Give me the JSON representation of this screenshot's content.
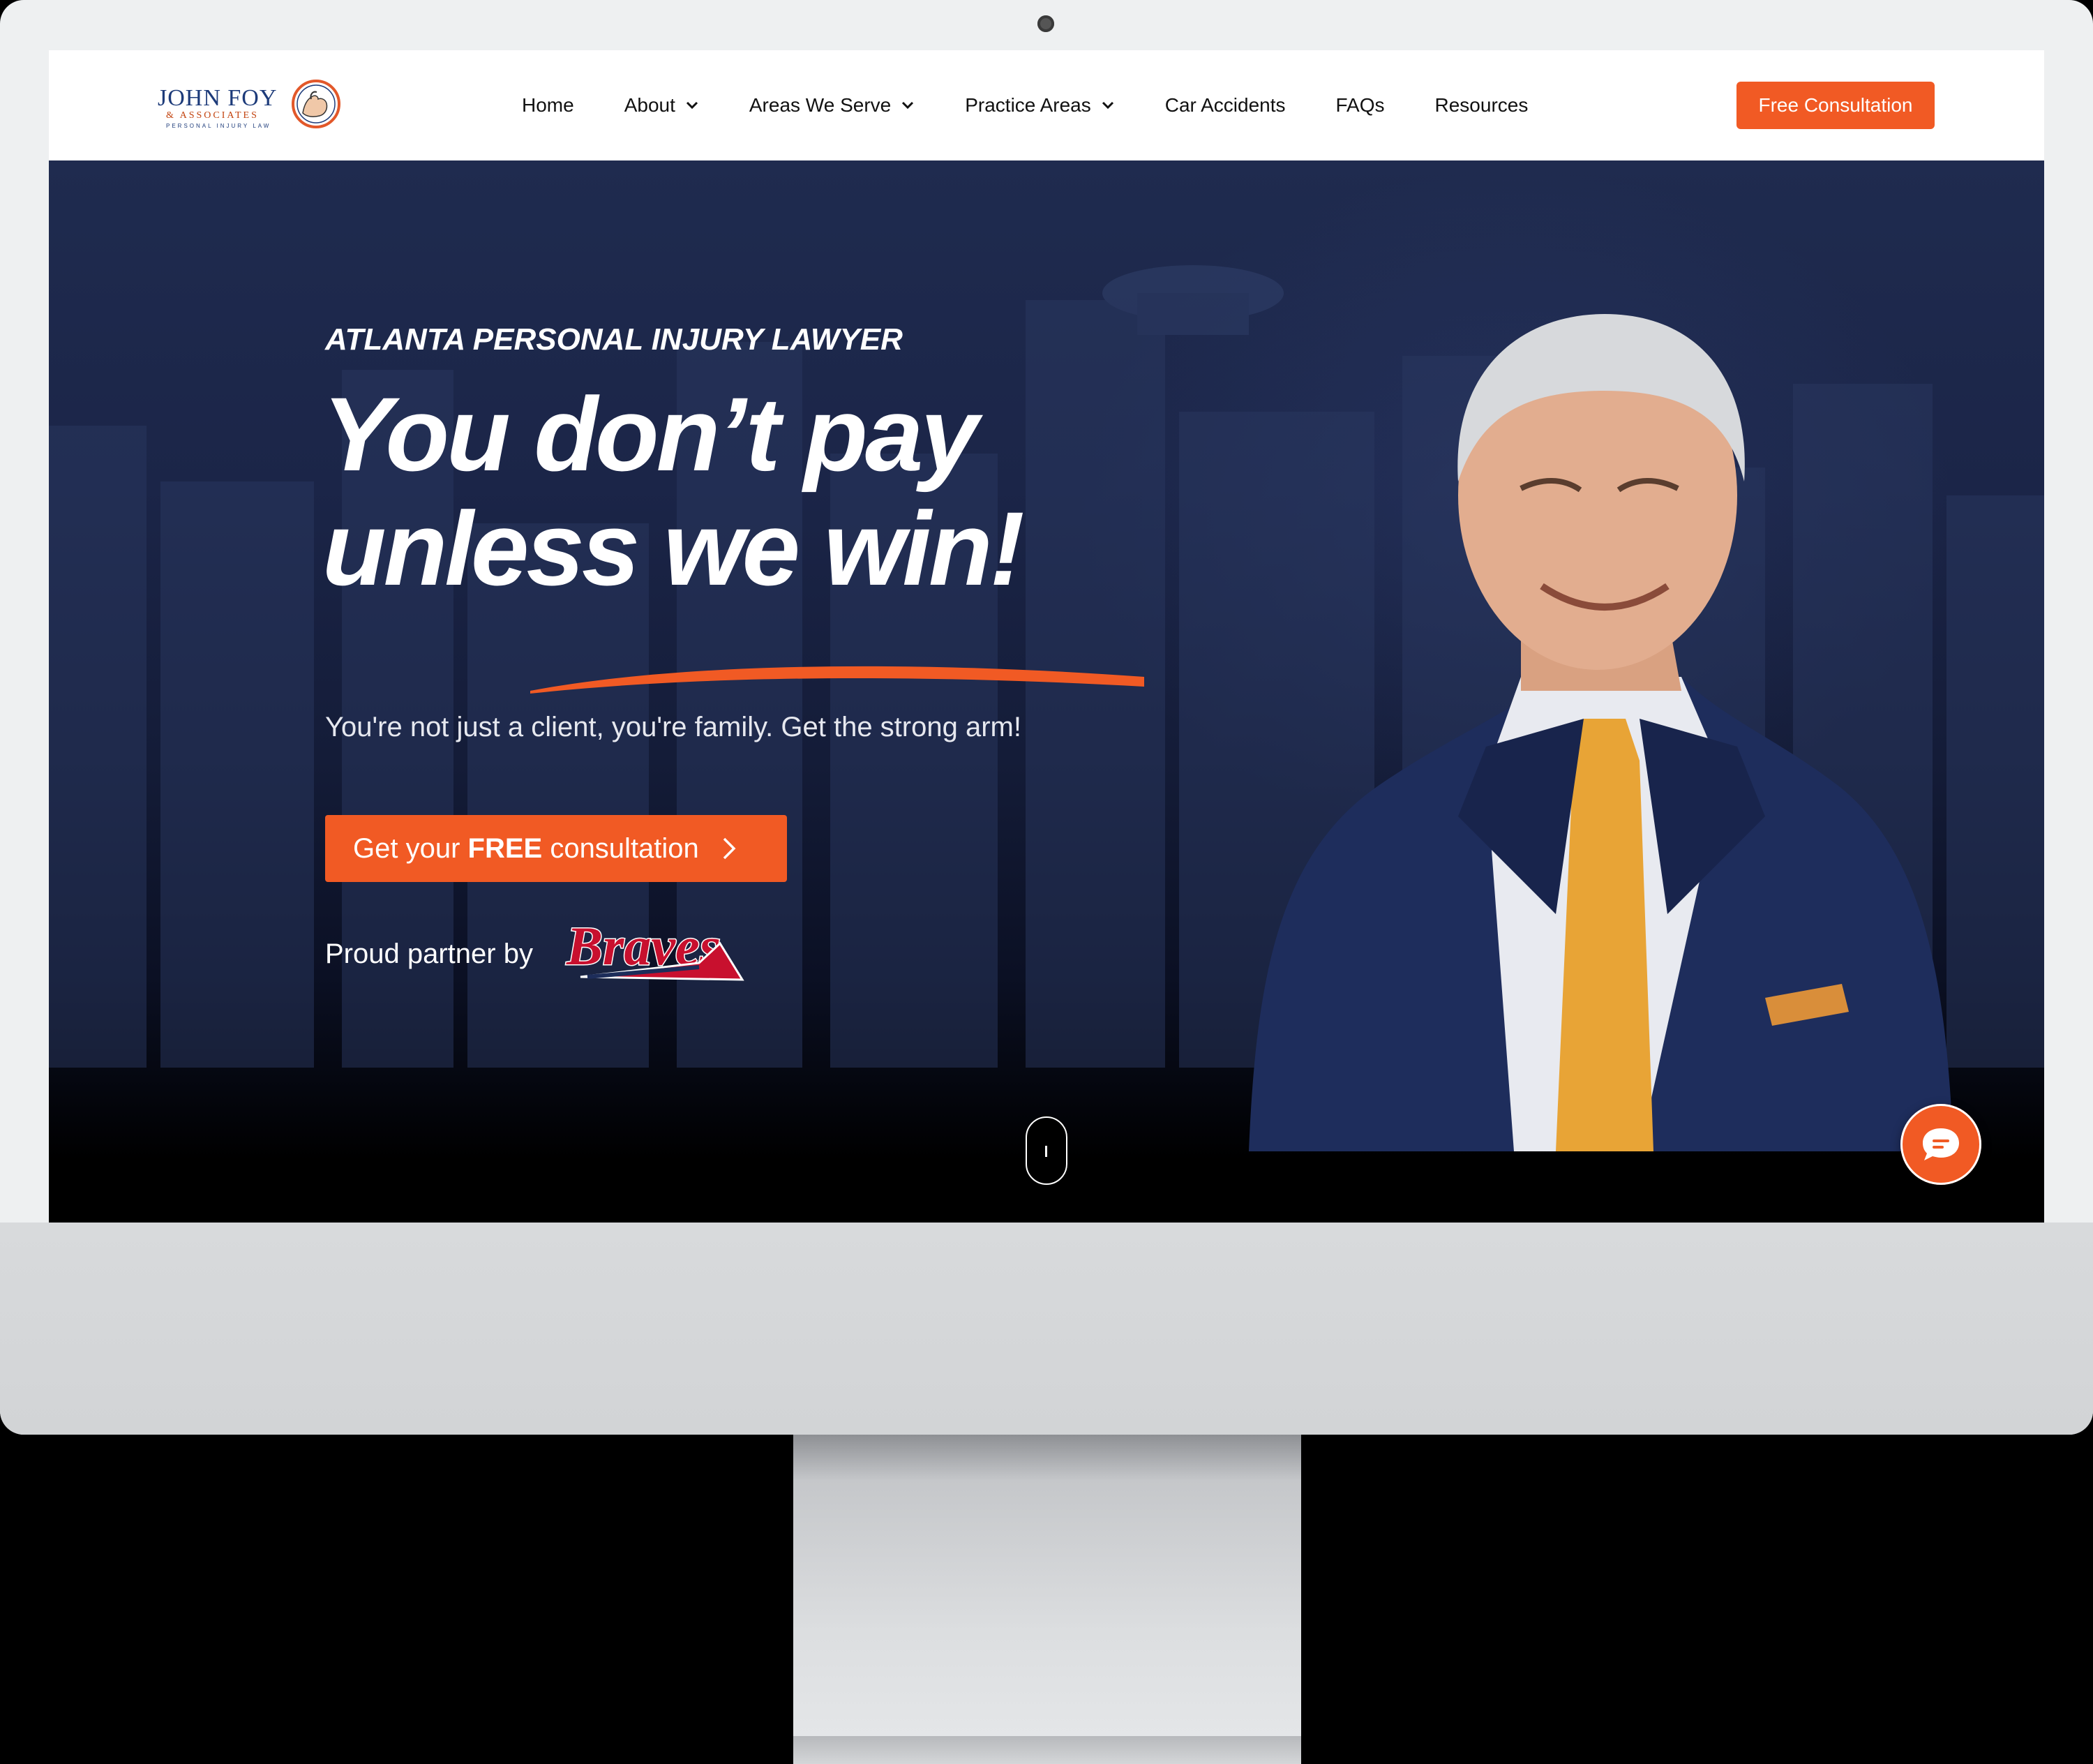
{
  "brand": {
    "logo_name": "JOHN FOY",
    "logo_sub": "& ASSOCIATES",
    "logo_tag": "PERSONAL INJURY LAW",
    "accent_color": "#f15a24",
    "navy_color": "#1d3b7a"
  },
  "nav": {
    "items": [
      {
        "label": "Home",
        "has_dropdown": false
      },
      {
        "label": "About",
        "has_dropdown": true
      },
      {
        "label": "Areas We Serve",
        "has_dropdown": true
      },
      {
        "label": "Practice Areas",
        "has_dropdown": true
      },
      {
        "label": "Car Accidents",
        "has_dropdown": false
      },
      {
        "label": "FAQs",
        "has_dropdown": false
      },
      {
        "label": "Resources",
        "has_dropdown": false
      }
    ],
    "cta_label": "Free Consultation"
  },
  "hero": {
    "eyebrow": "ATLANTA PERSONAL INJURY LAWYER",
    "headline_line1": "You don’t pay",
    "headline_line2": "unless we win!",
    "subtitle": "You're not just a client, you're family. Get the strong arm!",
    "button_prefix": "Get your ",
    "button_bold": "FREE",
    "button_suffix": " consultation",
    "partner_label": "Proud partner by",
    "partner_logo_text": "Braves"
  },
  "widgets": {
    "scroll_indicator_icon": "mouse-scroll-icon",
    "chat_icon": "chat-bubble-icon"
  }
}
